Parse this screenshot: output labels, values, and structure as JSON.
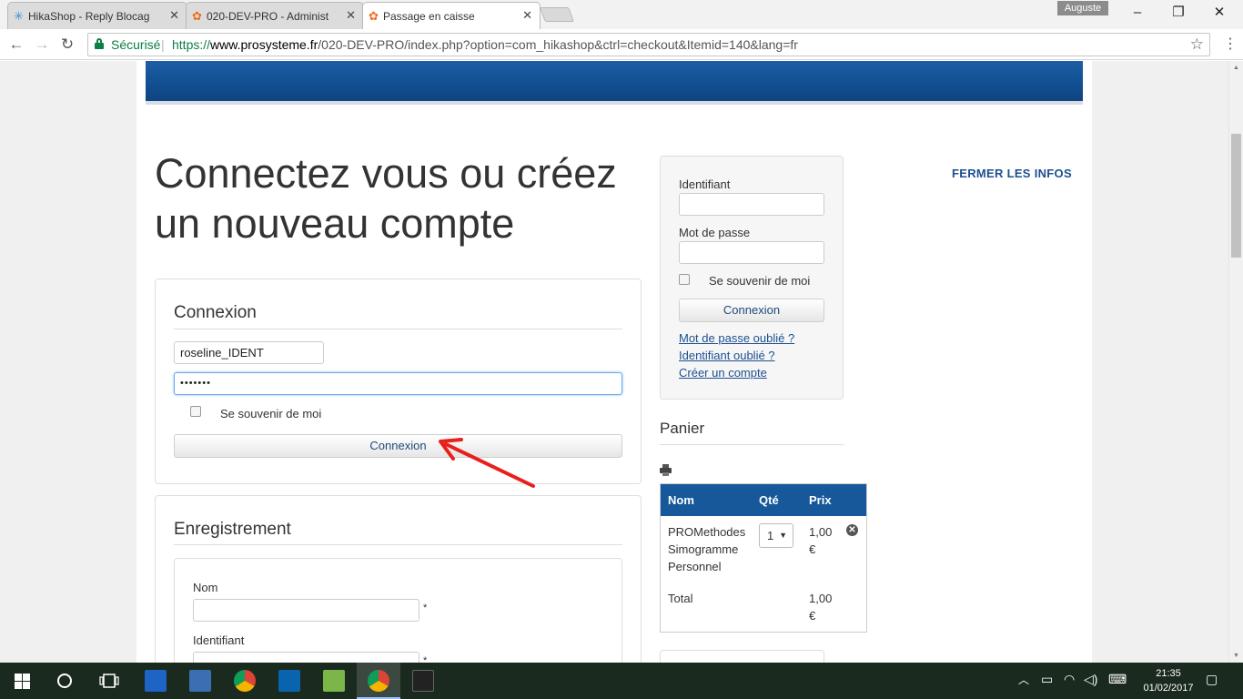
{
  "browser": {
    "tabs": [
      {
        "title": "HikaShop - Reply Blocag",
        "favicon": "hikashop-star-icon"
      },
      {
        "title": "020-DEV-PRO - Administ",
        "favicon": "joomla-icon"
      },
      {
        "title": "Passage en caisse",
        "favicon": "joomla-icon"
      }
    ],
    "profile_name": "Auguste",
    "secure_label": "Sécurisé",
    "url_scheme": "https://",
    "url_host": "www.prosysteme.fr",
    "url_path": "/020-DEV-PRO/index.php?option=com_hikashop&ctrl=checkout&Itemid=140&lang=fr"
  },
  "page": {
    "title": "Connectez vous ou créez un nouveau compte",
    "close_info": "FERMER LES INFOS",
    "login": {
      "heading": "Connexion",
      "username_value": "roseline_IDENT",
      "password_value": "•••••••",
      "remember_label": "Se souvenir de moi",
      "submit_label": "Connexion"
    },
    "register": {
      "heading": "Enregistrement",
      "name_label": "Nom",
      "username_label": "Identifiant",
      "required_mark": "*"
    },
    "side_login": {
      "username_label": "Identifiant",
      "password_label": "Mot de passe",
      "remember_label": "Se souvenir de moi",
      "submit_label": "Connexion",
      "forgot_password": "Mot de passe oublié ?",
      "forgot_username": "Identifiant oublié ?",
      "create_account": "Créer un compte"
    },
    "cart": {
      "title": "Panier",
      "columns": [
        "Nom",
        "Qté",
        "Prix"
      ],
      "item": {
        "name_lines": [
          "PROMethodes",
          "Simogramme",
          "Personnel"
        ],
        "quantity": "1",
        "price_lines": [
          "1,00",
          "€"
        ]
      },
      "total_label": "Total",
      "total_lines": [
        "1,00",
        "€"
      ]
    }
  },
  "taskbar": {
    "time": "21:35",
    "date": "01/02/2017"
  },
  "colors": {
    "banner": "#17589b",
    "link": "#1d4f91",
    "secure_green": "#0b8043",
    "annotation_arrow": "#e8201c"
  }
}
